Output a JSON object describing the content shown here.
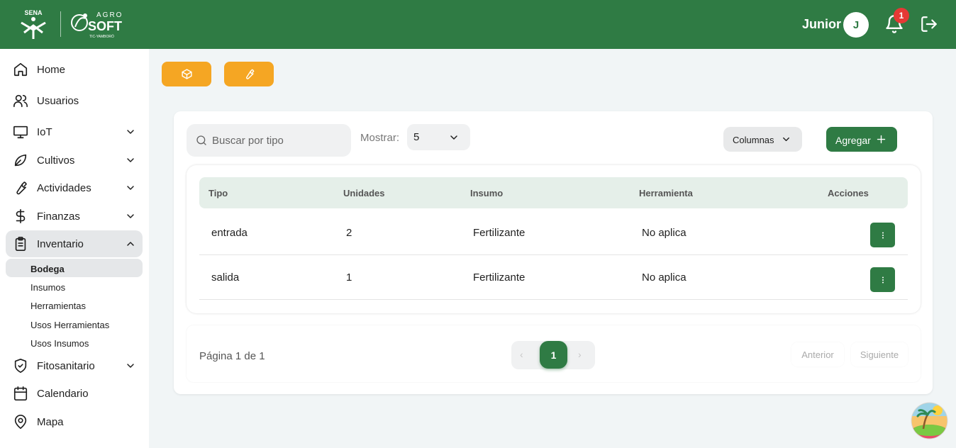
{
  "header": {
    "logo_sena_text": "SENA",
    "logo_agro_text": "AGRO",
    "logo_soft_text": "SOFT",
    "logo_sub_text": "TIC-YAMBORÓ",
    "user_name": "Junior",
    "avatar_initial": "J",
    "notification_count": "1",
    "bell_icon": "bell-icon",
    "logout_icon": "logout-icon",
    "brand_color": "#2f7b44"
  },
  "sidebar": {
    "items": [
      {
        "label": "Home",
        "icon": "home-icon"
      },
      {
        "label": "Usuarios",
        "icon": "users-icon"
      },
      {
        "label": "IoT",
        "icon": "monitor-icon"
      },
      {
        "label": "Cultivos",
        "icon": "leaf-icon"
      },
      {
        "label": "Actividades",
        "icon": "wrench-icon"
      },
      {
        "label": "Finanzas",
        "icon": "dollar-icon"
      },
      {
        "label": "Inventario",
        "icon": "clipboard-icon"
      },
      {
        "label": "Fitosanitario",
        "icon": "shield-icon"
      },
      {
        "label": "Calendario",
        "icon": "calendar-icon"
      },
      {
        "label": "Mapa",
        "icon": "map-pin-icon"
      }
    ],
    "inventario_sub": [
      {
        "label": "Bodega"
      },
      {
        "label": "Insumos"
      },
      {
        "label": "Herramientas"
      },
      {
        "label": "Usos Herramientas"
      },
      {
        "label": "Usos Insumos"
      }
    ]
  },
  "quick_actions": [
    {
      "icon": "box-icon"
    },
    {
      "icon": "wrench-icon"
    }
  ],
  "toolbar": {
    "search_placeholder": "Buscar por tipo",
    "show_label": "Mostrar:",
    "show_value": "5",
    "columns_label": "Columnas",
    "add_label": "Agregar"
  },
  "table": {
    "headers": [
      "Tipo",
      "Unidades",
      "Insumo",
      "Herramienta",
      "Acciones"
    ],
    "rows": [
      {
        "tipo": "entrada",
        "unidades": "2",
        "insumo": "Fertilizante",
        "herramienta": "No aplica"
      },
      {
        "tipo": "salida",
        "unidades": "1",
        "insumo": "Fertilizante",
        "herramienta": "No aplica"
      }
    ]
  },
  "pagination": {
    "page_text": "Página 1 de 1",
    "current": "1",
    "prev_arrow": "‹",
    "next_arrow": "›",
    "prev_label": "Anterior",
    "next_label": "Siguiente"
  },
  "colors": {
    "accent_orange": "#f5a623",
    "green": "#2f7b44"
  }
}
